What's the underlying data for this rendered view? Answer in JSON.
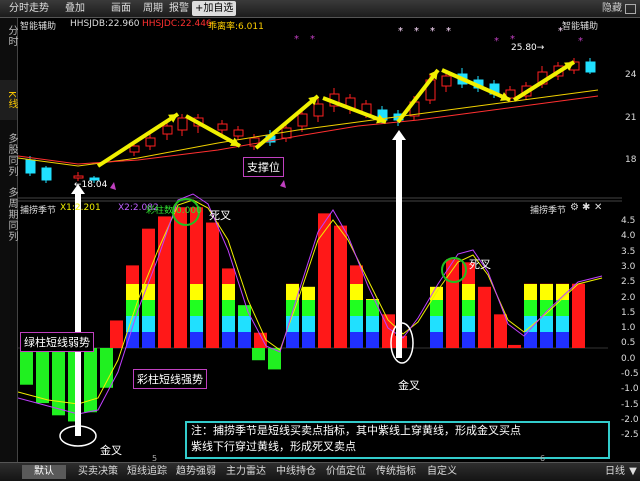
{
  "topbar": {
    "items": [
      "分时走势",
      "叠加",
      "画面",
      "周期",
      "报警",
      "+加自选"
    ],
    "hide": "隐藏"
  },
  "sidebar": {
    "tabs": [
      "分时",
      "K线",
      "多股同列",
      "多周期同列"
    ]
  },
  "kline": {
    "indicator_name": "智能辅助",
    "hhsjdb": "HHSJDB:22.960",
    "hhsjdc": "HHSJDC:22.446",
    "ratio": "乖离率:6.011",
    "right_label": "智能辅助",
    "low_label": "←18.04",
    "high_label": "25.80→",
    "support_label": "支撑位",
    "scale": [
      "24",
      "21",
      "18"
    ]
  },
  "oscillator": {
    "name": "捕捞季节",
    "x1": "X1:2.201",
    "x2": "X2:2.082",
    "colorbar": "彩柱数:0.000",
    "right_label": "捕捞季节",
    "scale": [
      "4.5",
      "4.0",
      "3.5",
      "3.0",
      "2.5",
      "2.0",
      "1.5",
      "1.0",
      "0.5",
      "0.0",
      "-0.5",
      "-1.0",
      "-1.5",
      "-2.0",
      "-2.5"
    ]
  },
  "labels": {
    "dead_cross_1": "死叉",
    "dead_cross_2": "死叉",
    "golden_cross_1": "金叉",
    "golden_cross_2": "金叉",
    "green_weak": "绿柱短线弱势",
    "color_strong": "彩柱短线强势"
  },
  "note": {
    "line1": "注：捕捞季节是短线买卖点指标，其中紫线上穿黄线，形成金叉买点",
    "line2": "紫线下行穿过黄线，形成死叉卖点"
  },
  "bottombar": {
    "tabs": [
      "默认",
      "买卖决策",
      "短线追踪",
      "趋势强弱",
      "主力雷达",
      "中线持仓",
      "价值定位",
      "传统指标",
      "自定义"
    ],
    "right": [
      "日线",
      "▼"
    ]
  },
  "xaxis": [
    "5",
    "6"
  ],
  "colors": {
    "up": "#ff2020",
    "down": "#20e0ff",
    "yellow": "#f0f000",
    "purple": "#c040ff",
    "green": "#20f020"
  }
}
